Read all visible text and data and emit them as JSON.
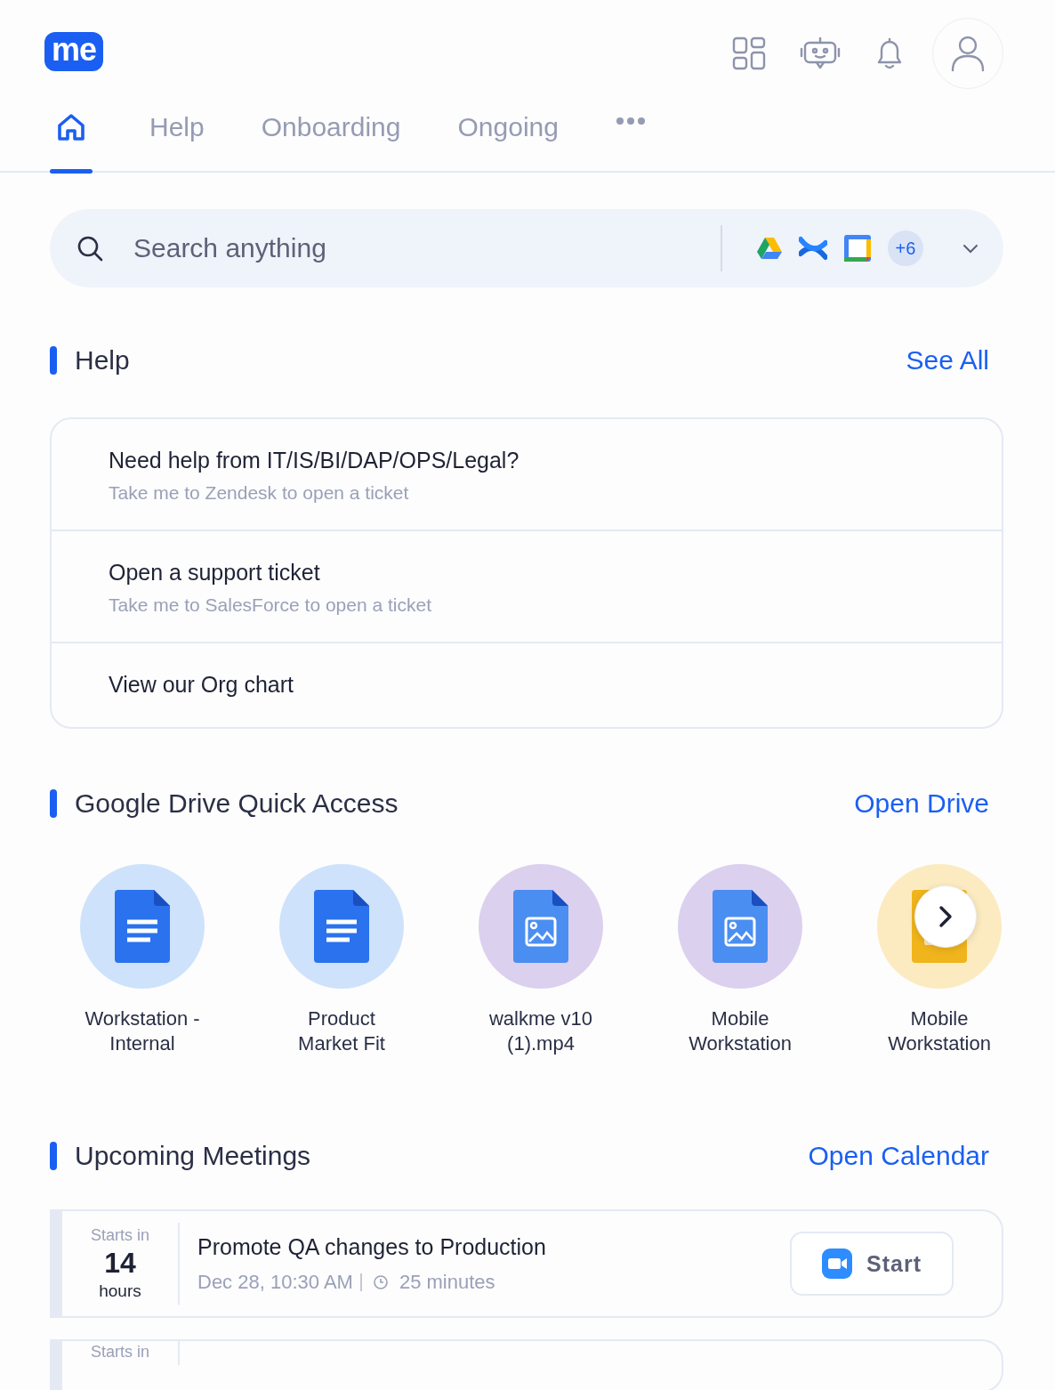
{
  "logo": {
    "text": "me"
  },
  "tabs": [
    {
      "kind": "home",
      "selected": true
    },
    {
      "kind": "text",
      "label": "Help",
      "selected": false
    },
    {
      "kind": "text",
      "label": "Onboarding",
      "selected": false
    },
    {
      "kind": "text",
      "label": "Ongoing",
      "selected": false
    },
    {
      "kind": "more",
      "selected": false
    }
  ],
  "search": {
    "placeholder": "Search anything",
    "extra_sources": "+6"
  },
  "help": {
    "title": "Help",
    "link": "See All",
    "items": [
      {
        "title": "Need help from IT/IS/BI/DAP/OPS/Legal?",
        "subtitle": "Take me to Zendesk to open a ticket"
      },
      {
        "title": "Open a support ticket",
        "subtitle": "Take me to SalesForce to open a ticket"
      },
      {
        "title": "View our Org chart"
      }
    ]
  },
  "drive": {
    "title": "Google Drive Quick Access",
    "link": "Open Drive",
    "files": [
      {
        "kind": "doc",
        "name": "Workstation - Internal"
      },
      {
        "kind": "doc",
        "name": "Product Market Fit"
      },
      {
        "kind": "image",
        "name": "walkme v10 (1).mp4"
      },
      {
        "kind": "image",
        "name": "Mobile Workstation"
      },
      {
        "kind": "slides",
        "name": "Mobile Workstation"
      }
    ]
  },
  "meetings": {
    "title": "Upcoming Meetings",
    "link": "Open Calendar",
    "items": [
      {
        "starts_label": "Starts in",
        "count": "14",
        "unit": "hours",
        "title": "Promote QA changes to Production",
        "when": "Dec 28, 10:30 AM",
        "duration": "25 minutes",
        "action": "Start"
      },
      {
        "starts_label": "Starts in"
      }
    ]
  }
}
